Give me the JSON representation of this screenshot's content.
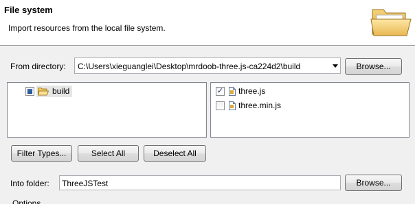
{
  "header": {
    "title": "File system",
    "description": "Import resources from the local file system."
  },
  "from_directory": {
    "label": "From directory:",
    "value": "C:\\Users\\xieguanglei\\Desktop\\mrdoob-three.js-ca224d2\\build",
    "browse_label": "Browse..."
  },
  "folder_tree": {
    "items": [
      {
        "label": "build",
        "checked": "partial",
        "icon": "folder-open-icon"
      }
    ]
  },
  "file_list": {
    "items": [
      {
        "label": "three.js",
        "checked": true,
        "icon": "javascript-file-icon"
      },
      {
        "label": "three.min.js",
        "checked": false,
        "icon": "javascript-file-icon"
      }
    ]
  },
  "actions": {
    "filter_types_label": "Filter Types...",
    "select_all_label": "Select All",
    "deselect_all_label": "Deselect All"
  },
  "into_folder": {
    "label": "Into folder:",
    "value": "ThreeJSTest",
    "browse_label": "Browse..."
  },
  "options": {
    "label": "Options"
  }
}
